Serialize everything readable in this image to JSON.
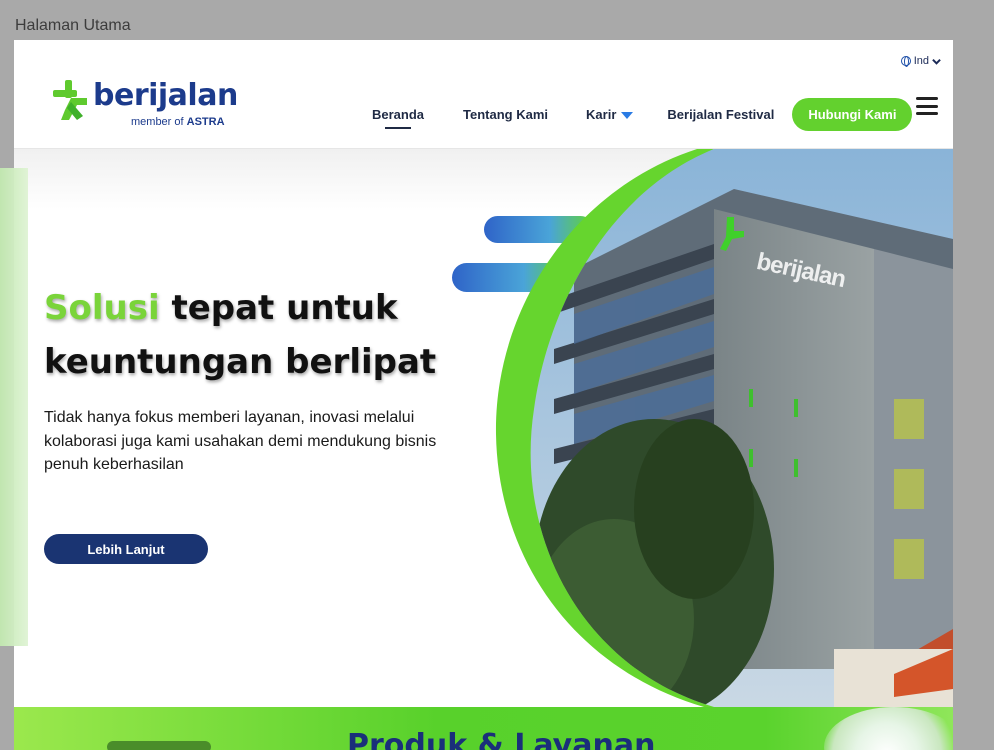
{
  "window": {
    "title": "Halaman Utama"
  },
  "header": {
    "language": "Ind",
    "logo": {
      "word": "berijalan",
      "tagline_prefix": "member of",
      "tagline_brand": "ASTRA"
    },
    "nav": {
      "beranda": "Beranda",
      "tentang": "Tentang Kami",
      "karir": "Karir",
      "festival": "Berijalan Festival"
    },
    "cta_contact": "Hubungi Kami"
  },
  "hero": {
    "title_accent": "Solusi",
    "title_rest_line1": "tepat untuk",
    "title_line2": "keuntungan berlipat",
    "description": "Tidak hanya fokus memberi layanan, inovasi melalui kolaborasi juga kami usahakan demi mendukung bisnis penuh keberhasilan",
    "cta_more": "Lebih Lanjut",
    "building_sign": "berijalan"
  },
  "section": {
    "title": "Produk & Layanan"
  },
  "colors": {
    "brand_green": "#63d12e",
    "brand_navy": "#1a3472",
    "accent_blue": "#2a7be4"
  }
}
